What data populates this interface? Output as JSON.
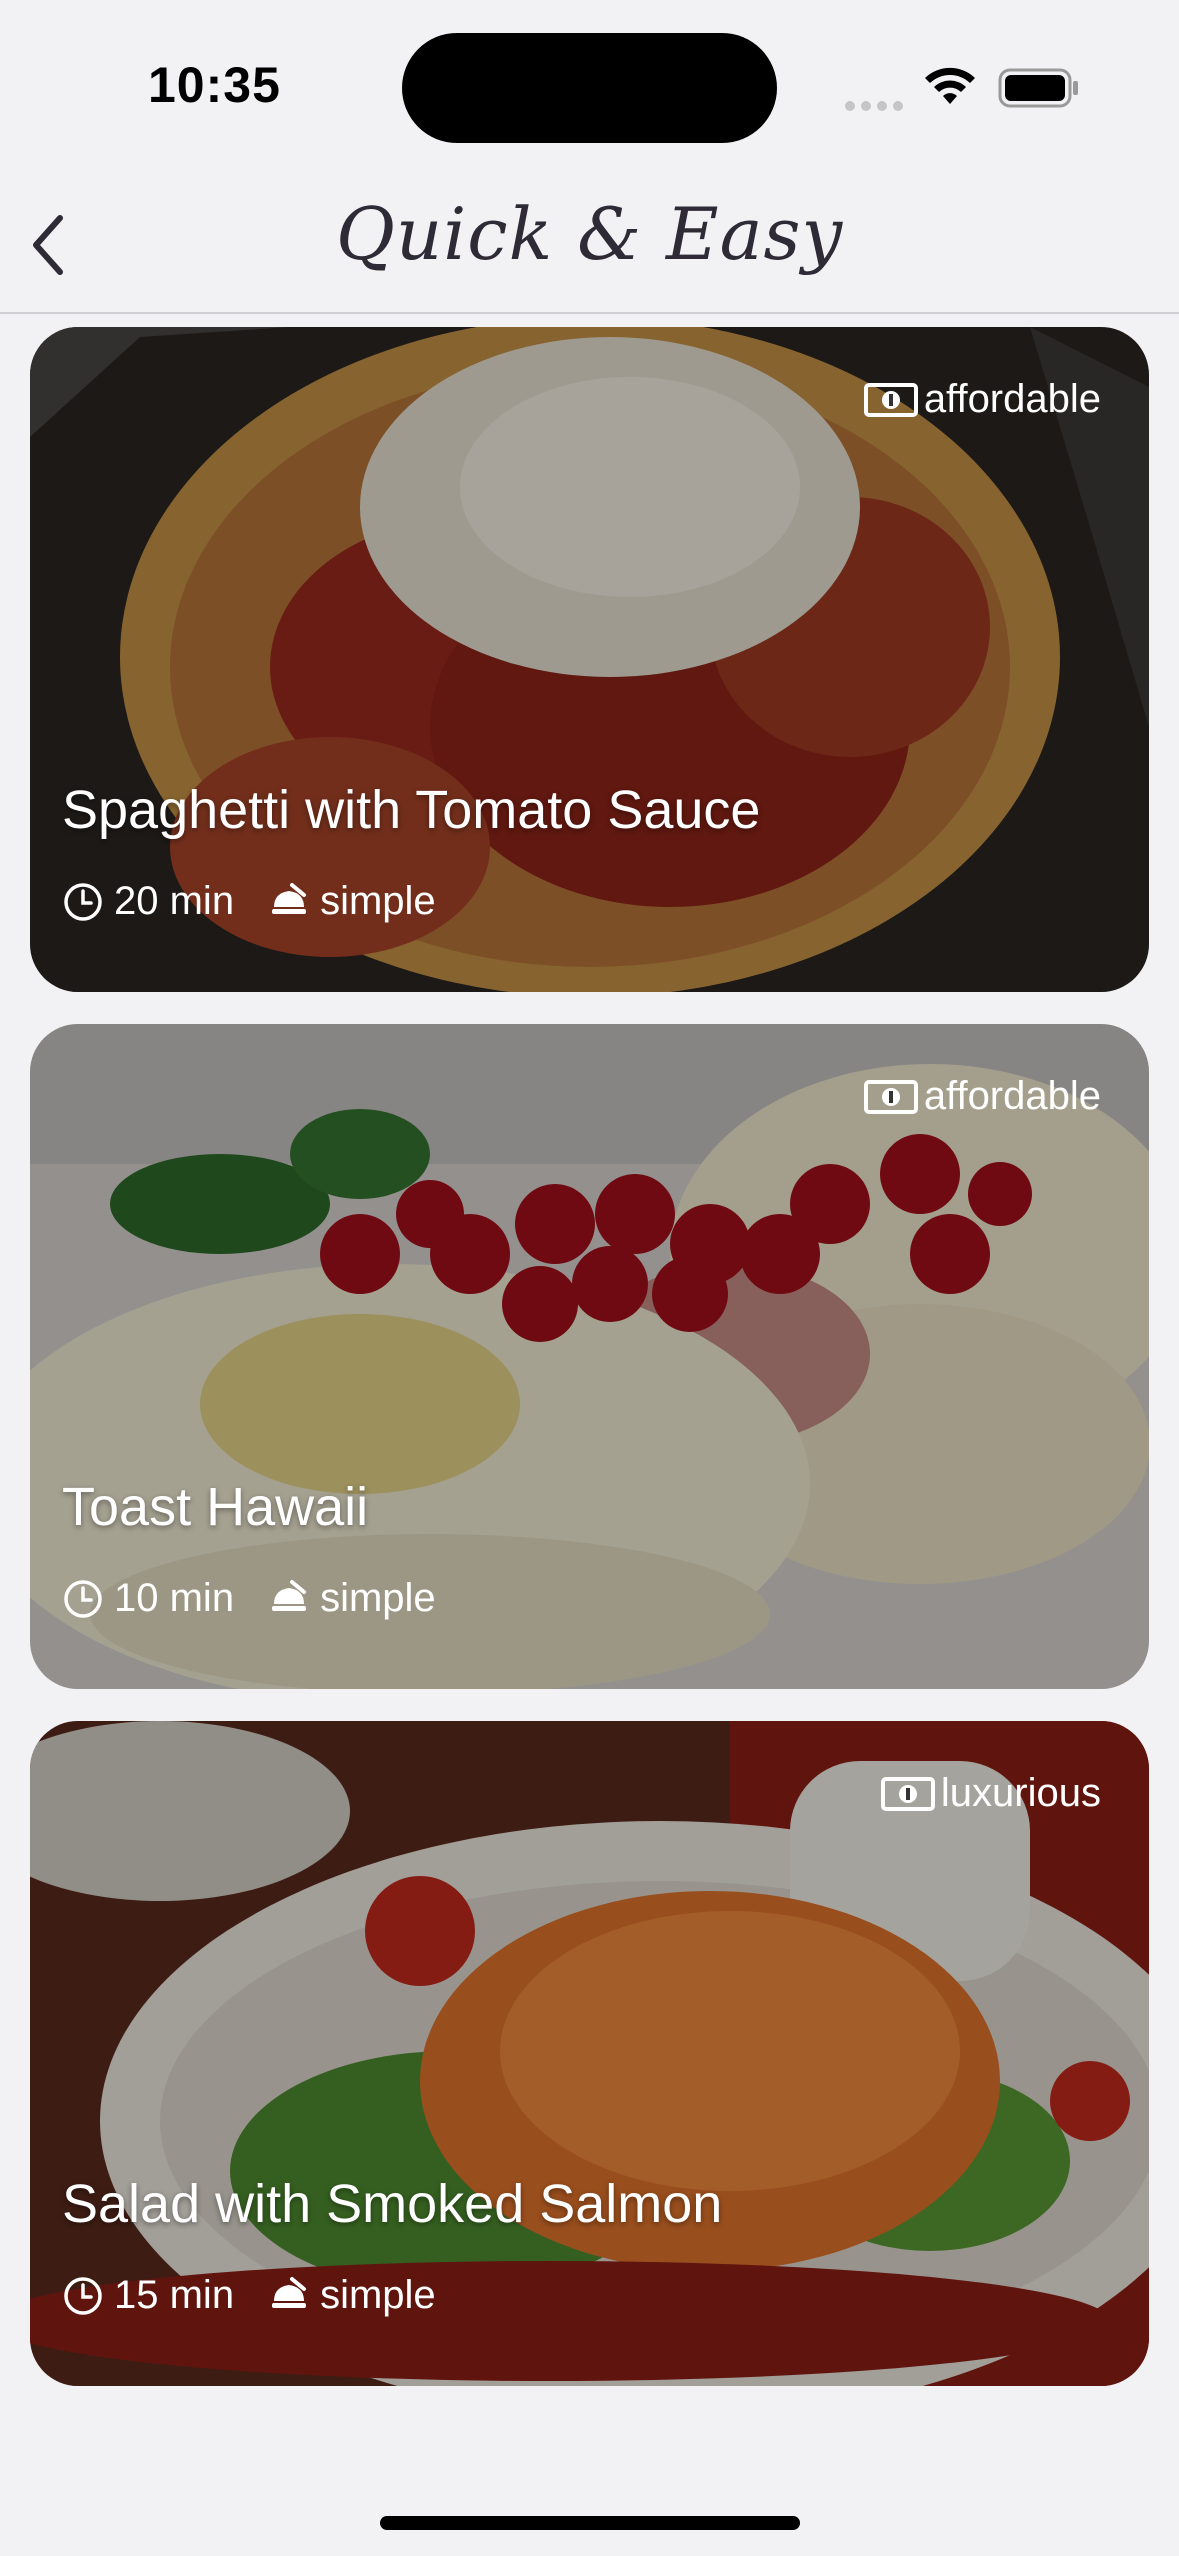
{
  "status_bar": {
    "time": "10:35"
  },
  "nav": {
    "title": "Quick & Easy",
    "back_icon": "chevron-left-icon"
  },
  "recipes": [
    {
      "title": "Spaghetti with Tomato Sauce",
      "duration": "20 min",
      "complexity": "simple",
      "affordability": "affordable"
    },
    {
      "title": "Toast Hawaii",
      "duration": "10 min",
      "complexity": "simple",
      "affordability": "affordable"
    },
    {
      "title": "Salad with Smoked Salmon",
      "duration": "15 min",
      "complexity": "simple",
      "affordability": "luxurious"
    }
  ],
  "icons": {
    "duration": "clock-icon",
    "complexity": "chef-icon",
    "affordability": "money-icon"
  },
  "colors": {
    "background": "#f2f2f4",
    "title": "#2e2a36",
    "overlay_text": "#ffffff"
  }
}
